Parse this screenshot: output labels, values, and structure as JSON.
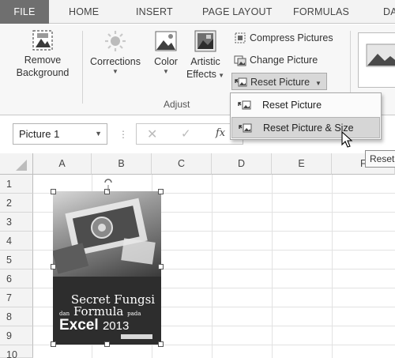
{
  "tabs": [
    "FILE",
    "HOME",
    "INSERT",
    "PAGE LAYOUT",
    "FORMULAS",
    "DA"
  ],
  "ribbon": {
    "remove_background": {
      "line1": "Remove",
      "line2": "Background"
    },
    "corrections": "Corrections",
    "color": "Color",
    "artistic_effects": {
      "line1": "Artistic",
      "line2": "Effects"
    },
    "compress_pictures": "Compress Pictures",
    "change_picture": "Change Picture",
    "reset_picture": "Reset Picture",
    "adjust_group": "Adjust"
  },
  "menu": {
    "items": [
      {
        "label": "Reset Picture"
      },
      {
        "label": "Reset Picture & Size"
      }
    ],
    "tooltip": "Reset"
  },
  "formula_bar": {
    "name_box": "Picture 1",
    "fx": "fx"
  },
  "grid": {
    "columns": [
      "A",
      "B",
      "C",
      "D",
      "E",
      "F"
    ],
    "rows": [
      "1",
      "2",
      "3",
      "4",
      "5",
      "6",
      "7",
      "8",
      "9",
      "10"
    ]
  },
  "picture": {
    "line1": "Secret Fungsi",
    "line2_small_a": "dan",
    "line2_main": "Formula",
    "line2_small_b": "pada",
    "line3_main": "Excel",
    "line3_year": "2013"
  }
}
